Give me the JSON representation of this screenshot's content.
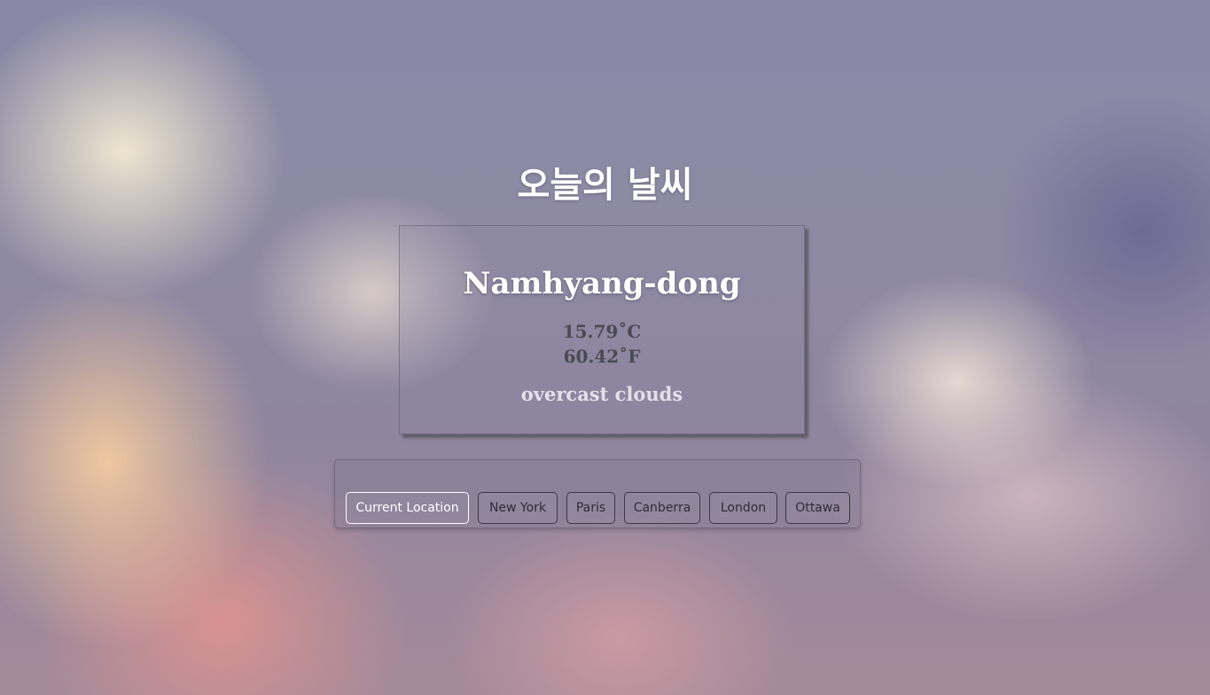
{
  "page": {
    "title": "오늘의 날씨"
  },
  "weather": {
    "city": "Namhyang-dong",
    "temp_c": "15.79˚C",
    "temp_f": "60.42˚F",
    "description": "overcast clouds"
  },
  "locations": {
    "buttons": [
      {
        "label": "Current Location",
        "active": true
      },
      {
        "label": "New York",
        "active": false
      },
      {
        "label": "Paris",
        "active": false
      },
      {
        "label": "Canberra",
        "active": false
      },
      {
        "label": "London",
        "active": false
      },
      {
        "label": "Ottawa",
        "active": false
      }
    ]
  },
  "colors": {
    "title_text": "#ffffff",
    "temp_text": "#4a4a52",
    "description_text": "#e4e0ea",
    "button_border": "#3b3846",
    "active_button_border": "#ffffff"
  }
}
